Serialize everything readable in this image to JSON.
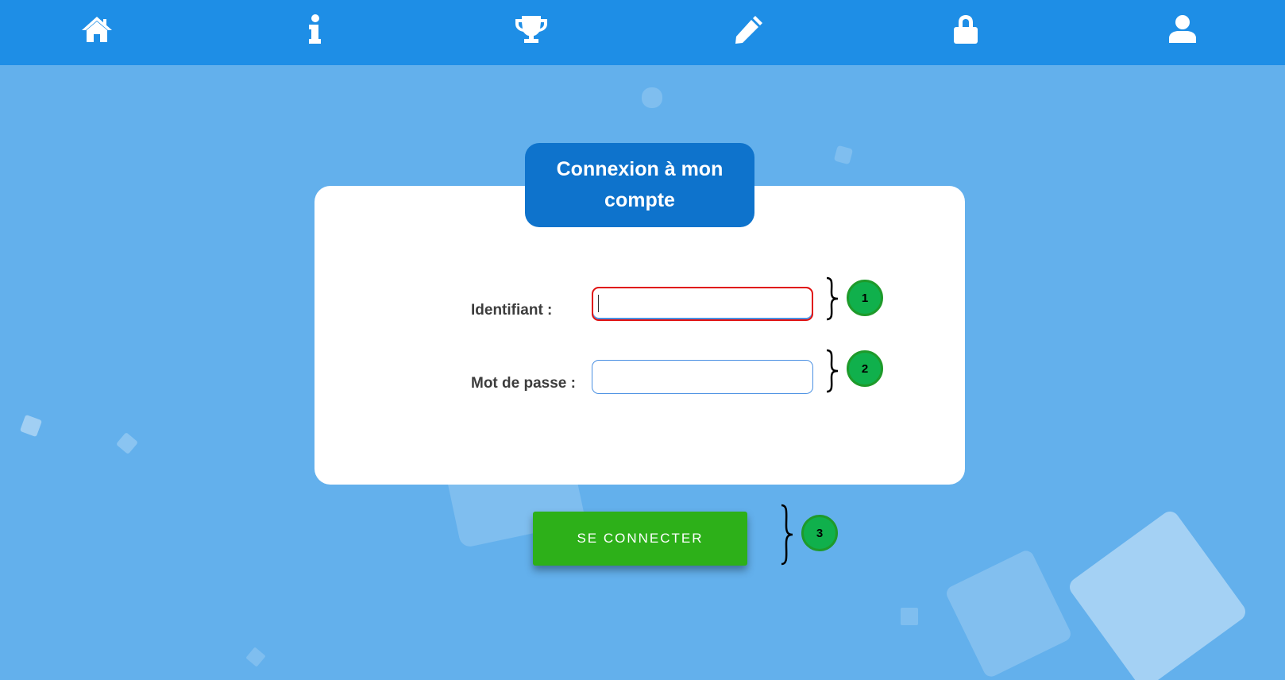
{
  "nav": {
    "items": [
      {
        "icon": "home-icon"
      },
      {
        "icon": "info-icon"
      },
      {
        "icon": "trophy-icon"
      },
      {
        "icon": "pencil-icon"
      },
      {
        "icon": "lock-icon"
      },
      {
        "icon": "user-icon"
      }
    ]
  },
  "login": {
    "title": "Connexion à mon compte",
    "username_label": "Identifiant :",
    "username_value": "",
    "password_label": "Mot de passe :",
    "password_value": "",
    "submit_label": "SE CONNECTER"
  },
  "annotations": [
    "1",
    "2",
    "3"
  ],
  "colors": {
    "page_background": "#63b0ec",
    "navbar": "#1e8ee6",
    "title_tab": "#0e73cc",
    "submit_button": "#2db019",
    "focus_border": "#e01010",
    "annotation_badge": "#10b04c"
  }
}
